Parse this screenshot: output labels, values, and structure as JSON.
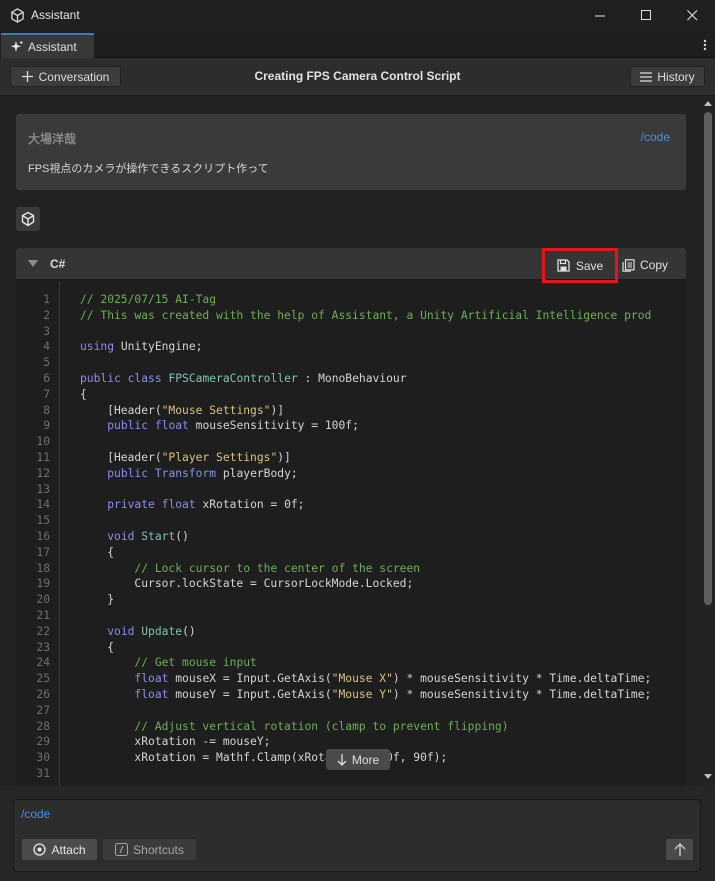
{
  "window": {
    "title": "Assistant"
  },
  "tabs": [
    {
      "label": "Assistant"
    }
  ],
  "header": {
    "conversation_label": "Conversation",
    "title": "Creating FPS Camera Control Script",
    "history_label": "History"
  },
  "user_message": {
    "author": "大場洋哉",
    "command": "/code",
    "text": "FPS視点のカメラが操作できるスクリプト作って"
  },
  "code_block": {
    "language": "C#",
    "save_label": "Save",
    "copy_label": "Copy",
    "line_numbers": [
      "1",
      "2",
      "3",
      "4",
      "5",
      "6",
      "7",
      "8",
      "9",
      "10",
      "11",
      "12",
      "13",
      "14",
      "15",
      "16",
      "17",
      "18",
      "19",
      "20",
      "21",
      "22",
      "23",
      "24",
      "25",
      "26",
      "27",
      "28",
      "29",
      "30",
      "31"
    ],
    "lines": [
      "// 2025/07/15 AI-Tag",
      "// This was created with the help of Assistant, a Unity Artificial Intelligence prod",
      "",
      "using UnityEngine;",
      "",
      "public class FPSCameraController : MonoBehaviour",
      "{",
      "    [Header(\"Mouse Settings\")]",
      "    public float mouseSensitivity = 100f;",
      "",
      "    [Header(\"Player Settings\")]",
      "    public Transform playerBody;",
      "",
      "    private float xRotation = 0f;",
      "",
      "    void Start()",
      "    {",
      "        // Lock cursor to the center of the screen",
      "        Cursor.lockState = CursorLockMode.Locked;",
      "    }",
      "",
      "    void Update()",
      "    {",
      "        // Get mouse input",
      "        float mouseX = Input.GetAxis(\"Mouse X\") * mouseSensitivity * Time.deltaTime;",
      "        float mouseY = Input.GetAxis(\"Mouse Y\") * mouseSensitivity * Time.deltaTime;",
      "",
      "        // Adjust vertical rotation (clamp to prevent flipping)",
      "        xRotation -= mouseY;",
      "        xRotation = Mathf.Clamp(xRotation, -90f, 90f);",
      ""
    ],
    "more_label": "More"
  },
  "input": {
    "value": "/code",
    "attach_label": "Attach",
    "shortcuts_label": "Shortcuts"
  },
  "icons": {
    "app": "unity-logo-icon",
    "minimize": "minimize-icon",
    "maximize": "maximize-icon",
    "close": "close-icon",
    "tab": "sparkle-icon",
    "menu": "kebab-menu-icon",
    "new_conversation": "plus-icon",
    "history": "hamburger-icon",
    "assistant_avatar": "unity-cube-icon",
    "collapse": "triangle-down-icon",
    "save": "floppy-disk-icon",
    "copy": "copy-icon",
    "more": "arrow-down-icon",
    "attach": "target-icon",
    "shortcuts": "slash-icon",
    "send": "arrow-up-icon"
  },
  "colors": {
    "accent_blue": "#4a90e2",
    "highlight_red": "#e3151a",
    "keyword": "#8a8ef0",
    "comment": "#6fae57",
    "string": "#d8c27d"
  }
}
